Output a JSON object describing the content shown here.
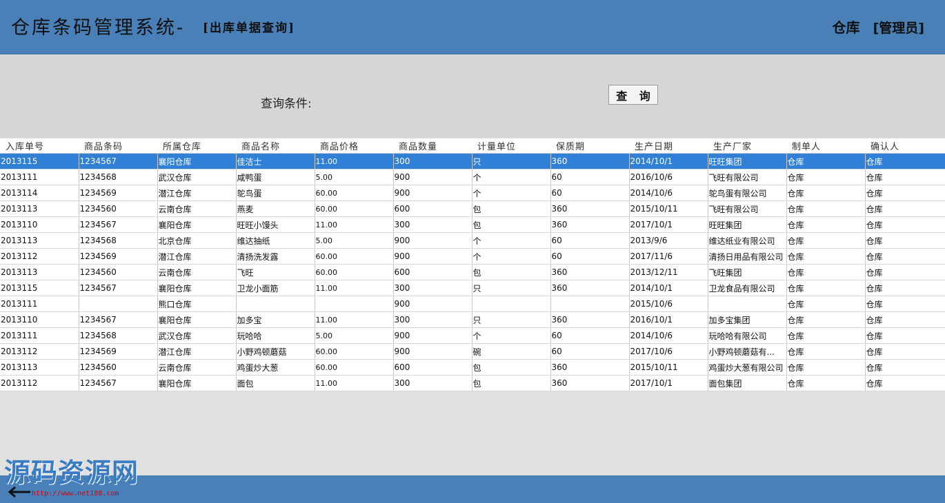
{
  "header": {
    "app_title": "仓库条码管理系统",
    "separator": "-",
    "page_name": "[出库单据查询]",
    "user_name": "仓库",
    "user_role": "[管理员]"
  },
  "filter": {
    "label": "查询条件:",
    "query_button": "查 询"
  },
  "table": {
    "columns": [
      "入库单号",
      "商品条码",
      "所属仓库",
      "商品名称",
      "商品价格",
      "商品数量",
      "计量单位",
      "保质期",
      "生产日期",
      "生产厂家",
      "制单人",
      "确认人"
    ],
    "rows": [
      [
        "2013115",
        "1234567",
        "襄阳仓库",
        "佳洁士",
        "11.00",
        "300",
        "只",
        "360",
        "2014/10/1",
        "旺旺集团",
        "仓库",
        "仓库"
      ],
      [
        "2013111",
        "1234568",
        "武汉仓库",
        "咸鸭蛋",
        "5.00",
        "900",
        "个",
        "60",
        "2016/10/6",
        "飞旺有限公司",
        "仓库",
        "仓库"
      ],
      [
        "2013114",
        "1234569",
        "潜江仓库",
        "鸵鸟蛋",
        "60.00",
        "900",
        "个",
        "60",
        "2014/10/6",
        "鸵鸟蛋有限公司",
        "仓库",
        "仓库"
      ],
      [
        "2013113",
        "1234560",
        "云南仓库",
        "燕麦",
        "60.00",
        "600",
        "包",
        "360",
        "2015/10/11",
        "飞旺有限公司",
        "仓库",
        "仓库"
      ],
      [
        "2013110",
        "1234567",
        "襄阳仓库",
        "旺旺小馒头",
        "11.00",
        "300",
        "包",
        "360",
        "2017/10/1",
        "旺旺集团",
        "仓库",
        "仓库"
      ],
      [
        "2013113",
        "1234568",
        "北京仓库",
        "维达抽纸",
        "5.00",
        "900",
        "个",
        "60",
        "2013/9/6",
        "维达纸业有限公司",
        "仓库",
        "仓库"
      ],
      [
        "2013112",
        "1234569",
        "潜江仓库",
        "清扬洗发露",
        "60.00",
        "900",
        "个",
        "60",
        "2017/11/6",
        "清扬日用品有限公司",
        "仓库",
        "仓库"
      ],
      [
        "2013113",
        "1234560",
        "云南仓库",
        "飞旺",
        "60.00",
        "600",
        "包",
        "360",
        "2013/12/11",
        "飞旺集团",
        "仓库",
        "仓库"
      ],
      [
        "2013115",
        "1234567",
        "襄阳仓库",
        "卫龙小面筋",
        "11.00",
        "300",
        "只",
        "360",
        "2014/10/1",
        "卫龙食品有限公司",
        "仓库",
        "仓库"
      ],
      [
        "2013111",
        "",
        "熊口仓库",
        "",
        "",
        "900",
        "",
        "",
        "2015/10/6",
        "",
        "仓库",
        "仓库"
      ],
      [
        "2013110",
        "1234567",
        "襄阳仓库",
        "加多宝",
        "11.00",
        "300",
        "只",
        "360",
        "2016/10/1",
        "加多宝集团",
        "仓库",
        "仓库"
      ],
      [
        "2013111",
        "1234568",
        "武汉仓库",
        "玩哈哈",
        "5.00",
        "900",
        "个",
        "60",
        "2014/10/6",
        "玩哈哈有限公司",
        "仓库",
        "仓库"
      ],
      [
        "2013112",
        "1234569",
        "潜江仓库",
        "小野鸡顿蘑菇",
        "60.00",
        "900",
        "碗",
        "60",
        "2017/10/6",
        "小野鸡顿蘑菇有...",
        "仓库",
        "仓库"
      ],
      [
        "2013113",
        "1234560",
        "云南仓库",
        "鸡蛋炒大葱",
        "60.00",
        "600",
        "包",
        "360",
        "2015/10/11",
        "鸡蛋炒大葱有限公司",
        "仓库",
        "仓库"
      ],
      [
        "2013112",
        "1234567",
        "襄阳仓库",
        "面包",
        "11.00",
        "300",
        "包",
        "360",
        "2017/10/1",
        "面包集团",
        "仓库",
        "仓库"
      ]
    ],
    "selected_row": 0,
    "selection_color": "#2f80d6"
  },
  "watermark": {
    "text": "源码资源网",
    "url": "http://www.net188.com"
  },
  "colors": {
    "header_bg": "#4a80b8",
    "panel_bg": "#d6d6d6"
  }
}
